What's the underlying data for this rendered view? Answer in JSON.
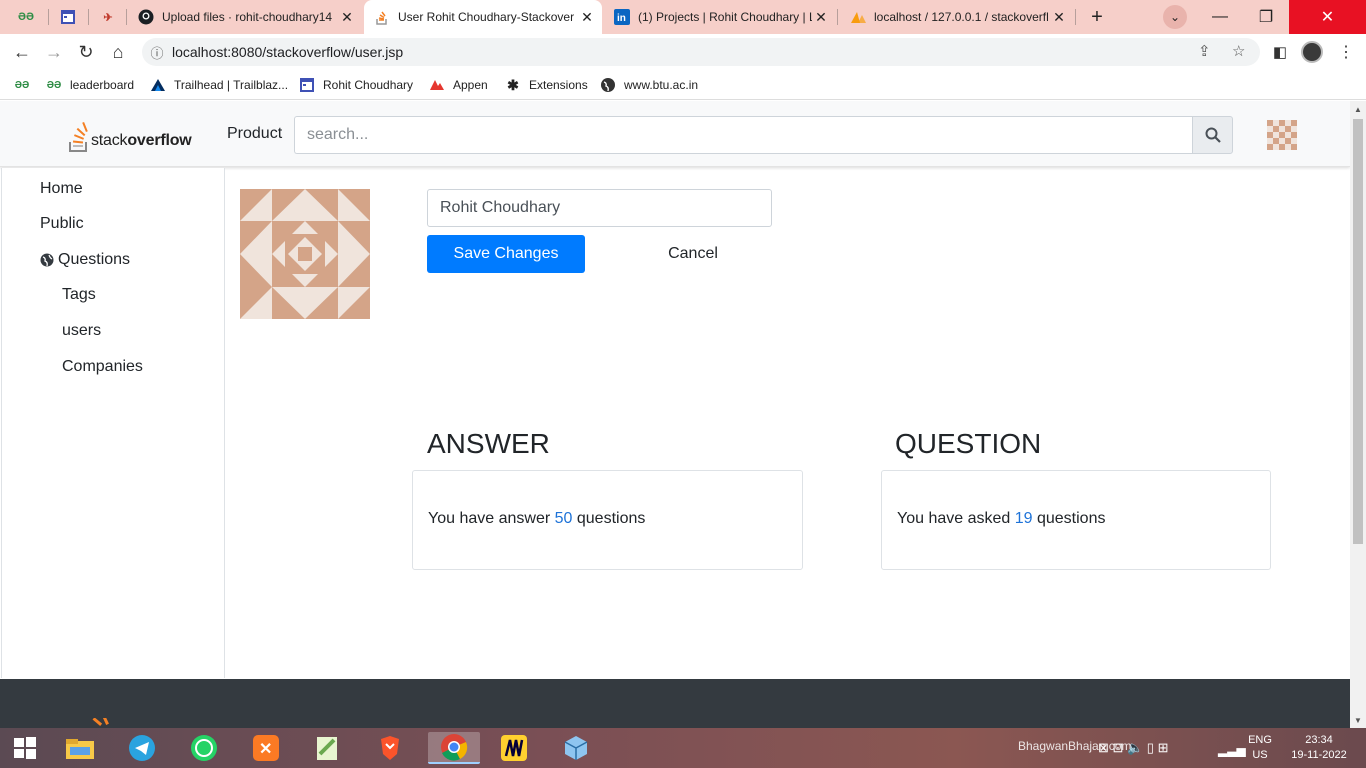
{
  "browser": {
    "tabs": [
      {
        "title": "",
        "favicon": "geeksforgeeks-icon",
        "active": false
      },
      {
        "title": "",
        "favicon": "calendar-app-icon",
        "active": false
      },
      {
        "title": "",
        "favicon": "rocket-icon",
        "active": false
      },
      {
        "title": "Upload files · rohit-choudhary14",
        "favicon": "github-icon",
        "active": false
      },
      {
        "title": "User Rohit Choudhary-Stackover",
        "favicon": "stackoverflow-icon",
        "active": true
      },
      {
        "title": "(1) Projects | Rohit Choudhary | L",
        "favicon": "linkedin-icon",
        "active": false
      },
      {
        "title": "localhost / 127.0.0.1 / stackoverfl",
        "favicon": "phpmyadmin-icon",
        "active": false
      }
    ],
    "url": "localhost:8080/stackoverflow/user.jsp",
    "bookmarks": [
      {
        "label": "",
        "icon": "geeksforgeeks-icon"
      },
      {
        "label": "leaderboard",
        "icon": "geeksforgeeks-icon"
      },
      {
        "label": "Trailhead | Trailblaz...",
        "icon": "trailhead-icon"
      },
      {
        "label": "Rohit Choudhary",
        "icon": "calendar-app-icon"
      },
      {
        "label": "Appen",
        "icon": "appen-icon"
      },
      {
        "label": "Extensions",
        "icon": "puzzle-icon"
      },
      {
        "label": "www.btu.ac.in",
        "icon": "globe-icon"
      }
    ]
  },
  "header": {
    "logo_prefix": "stack",
    "logo_bold": "overflow",
    "product_label": "Product",
    "search_placeholder": "search..."
  },
  "sidebar": {
    "items": [
      {
        "label": "Home"
      },
      {
        "label": "Public"
      },
      {
        "label": "Questions",
        "icon": "globe-icon"
      },
      {
        "label": "Tags"
      },
      {
        "label": "users"
      },
      {
        "label": "Companies"
      }
    ]
  },
  "profile": {
    "name_value": "Rohit Choudhary",
    "save_label": "Save Changes",
    "cancel_label": "Cancel"
  },
  "stats": {
    "answer": {
      "title": "ANSWER",
      "prefix": "You have answer",
      "count": "50",
      "suffix": "questions"
    },
    "question": {
      "title": "QUESTION",
      "prefix": "You have asked",
      "count": "19",
      "suffix": "questions"
    }
  },
  "taskbar": {
    "apps": [
      "windows-start-icon",
      "file-explorer-icon",
      "telegram-icon",
      "whatsapp-icon",
      "xampp-icon",
      "notepad-plus-icon",
      "brave-icon",
      "chrome-icon",
      "miro-icon",
      "virtualbox-icon"
    ],
    "wallpaper_text": "BhagwanBhajan.com",
    "language": "ENG",
    "region": "US",
    "time": "23:34",
    "date": "19-11-2022"
  },
  "colors": {
    "primary": "#007bff",
    "count_link": "#1e73d8",
    "footer": "#343a40",
    "avatar": "#d4a488",
    "tabstrip": "#f6cfc9"
  }
}
